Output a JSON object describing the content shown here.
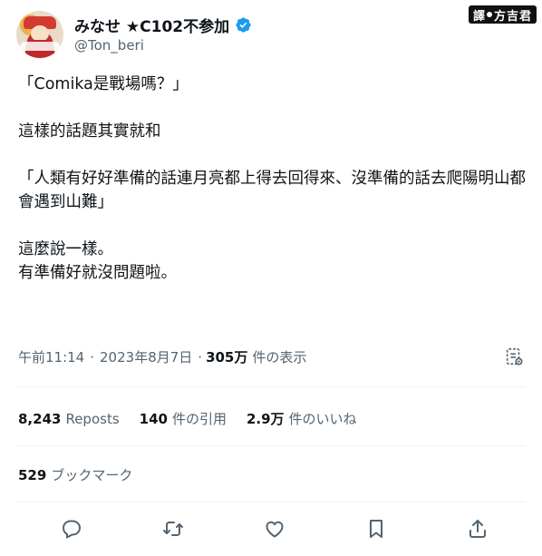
{
  "author": {
    "display_name": "みなせ ★C102不参加",
    "handle": "@Ton_beri",
    "verified": true,
    "verified_color": "#1d9bf0"
  },
  "translator_badge": {
    "label": "譯",
    "name": "方吉君"
  },
  "tweet": {
    "lines": [
      "「Comika是戰場嗎？」",
      "",
      "這樣的話題其實就和",
      "",
      "「人類有好好準備的話連月亮都上得去回得來、沒準備的話去爬陽明山都會遇到山難」",
      "",
      "這麼說一樣。",
      "有準備好就沒問題啦。"
    ]
  },
  "meta": {
    "time": "午前11:14",
    "separator1": "·",
    "date": "2023年8月7日",
    "separator2": "·",
    "views_count": "305万",
    "views_label": "件の表示"
  },
  "stats": {
    "reposts_count": "8,243",
    "reposts_label": "Reposts",
    "quotes_count": "140",
    "quotes_label": "件の引用",
    "likes_count": "2.9万",
    "likes_label": "件のいいね",
    "bookmarks_count": "529",
    "bookmarks_label": "ブックマーク"
  },
  "icons": {
    "reply": "reply-icon",
    "repost": "repost-icon",
    "like": "like-icon",
    "bookmark": "bookmark-icon",
    "share": "share-icon",
    "analytics": "analytics-icon"
  },
  "colors": {
    "text": "#0f1419",
    "secondary": "#536471",
    "divider": "#eff3f4"
  }
}
